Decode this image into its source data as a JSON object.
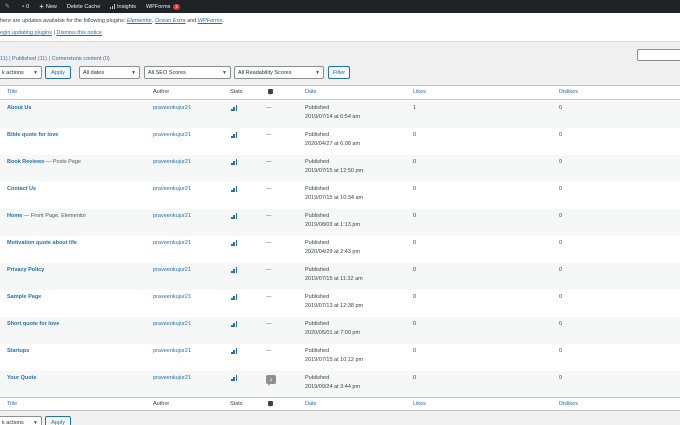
{
  "adminbar": {
    "items": [
      {
        "icon": "customize-icon",
        "label": ""
      },
      {
        "icon": "comment-icon",
        "label": "0"
      },
      {
        "icon": "plus-icon",
        "label": "New"
      },
      {
        "icon": "",
        "label": "Delete Cache"
      },
      {
        "icon": "insights-icon",
        "label": "Insights"
      },
      {
        "icon": "",
        "label": "WPForms",
        "badge": "2"
      }
    ]
  },
  "notice": {
    "text_prefix": "here are updates available for the following plugins: ",
    "plugin1": "Elementor",
    "sep1": ", ",
    "plugin2": "Ocean Extra",
    "sep2": " and ",
    "plugin3": "WPForms",
    "text_suffix": ".",
    "begin_link": "egin updating plugins",
    "divider": " | ",
    "dismiss_link": "Dismiss this notice"
  },
  "subsub": {
    "all": "11)",
    "sep1": " | ",
    "published": "Published",
    "published_count": " (11)",
    "sep2": " | ",
    "cornerstone": "Cornerstone content",
    "cornerstone_count": " (0)"
  },
  "filters": {
    "bulk_actions": "k actions",
    "apply": "Apply",
    "dates": "All dates",
    "seo": "All SEO Scores",
    "readability": "All Readability Scores",
    "filter": "Filter"
  },
  "columns": {
    "title": "Title",
    "author": "Author",
    "stats": "Stats",
    "date": "Date",
    "likes": "Likes",
    "dislikes": "Dislikes"
  },
  "rows": [
    {
      "title": "About Us",
      "state": "",
      "author": "praveenkujur21",
      "comments": "—",
      "status": "Published",
      "date": "2019/07/14 at 6:54 am",
      "likes": "1",
      "dislikes": "0"
    },
    {
      "title": "Bible quote for love",
      "state": "",
      "author": "praveenkujur21",
      "comments": "—",
      "status": "Published",
      "date": "2020/04/27 at 6:08 am",
      "likes": "0",
      "dislikes": "0"
    },
    {
      "title": "Book Reviews",
      "state": " — Posts Page",
      "author": "praveenkujur21",
      "comments": "—",
      "status": "Published",
      "date": "2019/07/15 at 12:50 pm",
      "likes": "0",
      "dislikes": "0"
    },
    {
      "title": "Contact Us",
      "state": "",
      "author": "praveenkujur21",
      "comments": "—",
      "status": "Published",
      "date": "2019/07/15 at 10:34 am",
      "likes": "0",
      "dislikes": "0"
    },
    {
      "title": "Home",
      "state": " — Front Page, Elementor",
      "author": "praveenkujur21",
      "comments": "—",
      "status": "Published",
      "date": "2019/08/03 at 1:13 pm",
      "likes": "0",
      "dislikes": "0"
    },
    {
      "title": "Motivation quote about life",
      "state": "",
      "author": "praveenkujur21",
      "comments": "—",
      "status": "Published",
      "date": "2020/04/29 at 2:43 pm",
      "likes": "0",
      "dislikes": "0"
    },
    {
      "title": "Privacy Policy",
      "state": "",
      "author": "praveenkujur21",
      "comments": "—",
      "status": "Published",
      "date": "2019/07/15 at 11:32 am",
      "likes": "0",
      "dislikes": "0"
    },
    {
      "title": "Sample Page",
      "state": "",
      "author": "praveenkujur21",
      "comments": "—",
      "status": "Published",
      "date": "2019/07/13 at 12:38 pm",
      "likes": "0",
      "dislikes": "0"
    },
    {
      "title": "Short quote for love",
      "state": "",
      "author": "praveenkujur21",
      "comments": "—",
      "status": "Published",
      "date": "2020/05/01 at 7:00 pm",
      "likes": "0",
      "dislikes": "0"
    },
    {
      "title": "Startups",
      "state": "",
      "author": "praveenkujur21",
      "comments": "—",
      "status": "Published",
      "date": "2019/07/15 at 10:12 pm",
      "likes": "0",
      "dislikes": "0"
    },
    {
      "title": "Your Quote",
      "state": "",
      "author": "praveenkujur21",
      "comments": "1",
      "status": "Published",
      "date": "2019/09/24 at 3:44 pm",
      "likes": "0",
      "dislikes": "0"
    }
  ],
  "colors": {
    "link": "#2271b1",
    "adminbar": "#1d2327",
    "badge": "#d63638"
  }
}
